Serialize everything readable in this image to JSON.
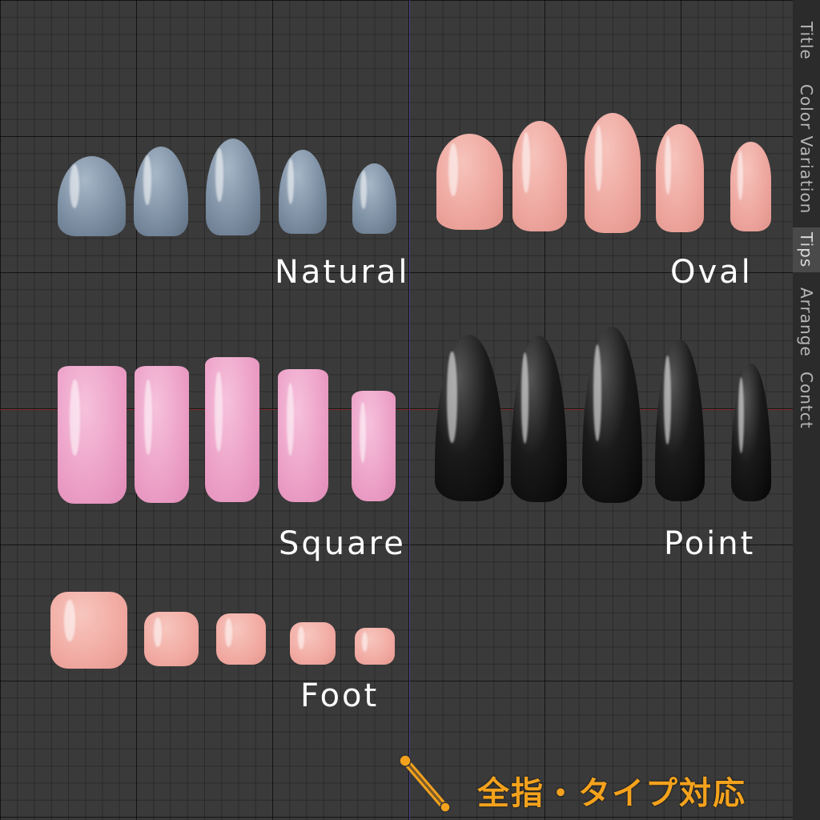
{
  "sidebar": {
    "tabs": [
      {
        "label": "Title",
        "active": false
      },
      {
        "label": "Color Variation",
        "active": false
      },
      {
        "label": "Tips",
        "active": true
      },
      {
        "label": "Arrange",
        "active": false
      },
      {
        "label": "Contct",
        "active": false
      }
    ]
  },
  "groups": {
    "natural": {
      "label": "Natural",
      "color": "#7d8fa3"
    },
    "oval": {
      "label": "Oval",
      "color": "#eda59d"
    },
    "square": {
      "label": "Square",
      "color": "#ec9fc6"
    },
    "point": {
      "label": "Point",
      "color": "#0a0a0a"
    },
    "foot": {
      "label": "Foot",
      "color": "#f1aaa2"
    }
  },
  "footer": {
    "caption": "全指・タイプ対応",
    "icon": "nail-file-icon",
    "accent_color": "#f4a21d"
  }
}
